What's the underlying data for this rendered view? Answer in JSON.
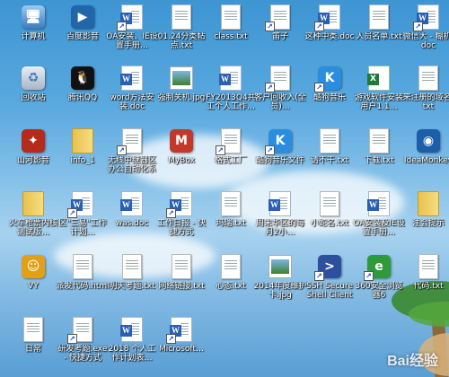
{
  "desktop": {
    "icons": [
      {
        "label": "计算机",
        "type": "computer",
        "shortcut": false
      },
      {
        "label": "百度影音",
        "type": "app-film",
        "shortcut": false
      },
      {
        "label": "OA安装、IE设置手册…",
        "type": "word",
        "shortcut": true
      },
      {
        "label": "01.24分类帖点.txt",
        "type": "txt",
        "shortcut": false
      },
      {
        "label": "class.txt",
        "type": "txt",
        "shortcut": false
      },
      {
        "label": "笛子",
        "type": "doc",
        "shortcut": true
      },
      {
        "label": "这种中类.doc",
        "type": "word",
        "shortcut": true
      },
      {
        "label": "人员名单.txt",
        "type": "txt",
        "shortcut": false
      },
      {
        "label": "微信大 - 糊机.doc",
        "type": "word",
        "shortcut": true
      },
      {
        "label": "回收站",
        "type": "recycle",
        "shortcut": false
      },
      {
        "label": "腾讯QQ",
        "type": "qq",
        "shortcut": false
      },
      {
        "label": "word方法安装.doc",
        "type": "word",
        "shortcut": false
      },
      {
        "label": "强制关机.jpg",
        "type": "image",
        "shortcut": false
      },
      {
        "label": "FY2013Q4共工个人工作…",
        "type": "word",
        "shortcut": false
      },
      {
        "label": "客户回收入(全员)…",
        "type": "doc",
        "shortcut": true
      },
      {
        "label": "酷狗音乐",
        "type": "kugou",
        "shortcut": true
      },
      {
        "label": "游戏软件安装用户1.1…",
        "type": "excel",
        "shortcut": false
      },
      {
        "label": "来注册的域名.txt",
        "type": "txt",
        "shortcut": false
      },
      {
        "label": "山河影音",
        "type": "app-red",
        "shortcut": false
      },
      {
        "label": "info_1",
        "type": "folder",
        "shortcut": false
      },
      {
        "label": "无线中继器区办公自动化系统",
        "type": "doc",
        "shortcut": true
      },
      {
        "label": "MyBox",
        "type": "app-mybox",
        "shortcut": false
      },
      {
        "label": "格式工厂",
        "type": "doc",
        "shortcut": true
      },
      {
        "label": "酷狗音乐文件",
        "type": "kugou",
        "shortcut": true
      },
      {
        "label": "请不干.txt",
        "type": "txt",
        "shortcut": false
      },
      {
        "label": "下载.txt",
        "type": "txt",
        "shortcut": false
      },
      {
        "label": "IdeaMonkey",
        "type": "app-monkey",
        "shortcut": false
      },
      {
        "label": "火车枪票内核测试版…",
        "type": "folder",
        "shortcut": false
      },
      {
        "label": "区\"三易\"工作计划…",
        "type": "word",
        "shortcut": true
      },
      {
        "label": "was.doc",
        "type": "word",
        "shortcut": false
      },
      {
        "label": "工作日报 - 快捷方式",
        "type": "word",
        "shortcut": true
      },
      {
        "label": "玛瑞.txt",
        "type": "txt",
        "shortcut": false
      },
      {
        "label": "周末华区的每月2小…",
        "type": "word",
        "shortcut": false
      },
      {
        "label": "小蛇名.txt",
        "type": "txt",
        "shortcut": false
      },
      {
        "label": "OA安装及IE设置手册…",
        "type": "word",
        "shortcut": false
      },
      {
        "label": "注会提示",
        "type": "folder",
        "shortcut": false
      },
      {
        "label": "VY",
        "type": "app-vy",
        "shortcut": false
      },
      {
        "label": "派发代码.html",
        "type": "doc",
        "shortcut": false
      },
      {
        "label": "明天考题.txt",
        "type": "txt",
        "shortcut": false
      },
      {
        "label": "网络链接.txt",
        "type": "txt",
        "shortcut": false
      },
      {
        "label": "心态.txt",
        "type": "txt",
        "shortcut": false
      },
      {
        "label": "2014年度维护卡.jpg",
        "type": "image",
        "shortcut": false
      },
      {
        "label": "SSH Secure Shell Client",
        "type": "app-ssh",
        "shortcut": true
      },
      {
        "label": "360安全浏览器6",
        "type": "app-360",
        "shortcut": true
      },
      {
        "label": "代码.txt",
        "type": "txt",
        "shortcut": false
      },
      {
        "label": "日常",
        "type": "doc",
        "shortcut": false
      },
      {
        "label": "研发考题.exe - 快捷方式",
        "type": "doc",
        "shortcut": true
      },
      {
        "label": "2018 个人工作计划表…",
        "type": "word",
        "shortcut": false
      },
      {
        "label": "Microsoft…",
        "type": "word",
        "shortcut": true
      }
    ]
  },
  "watermark": {
    "text": "Bai经验"
  }
}
